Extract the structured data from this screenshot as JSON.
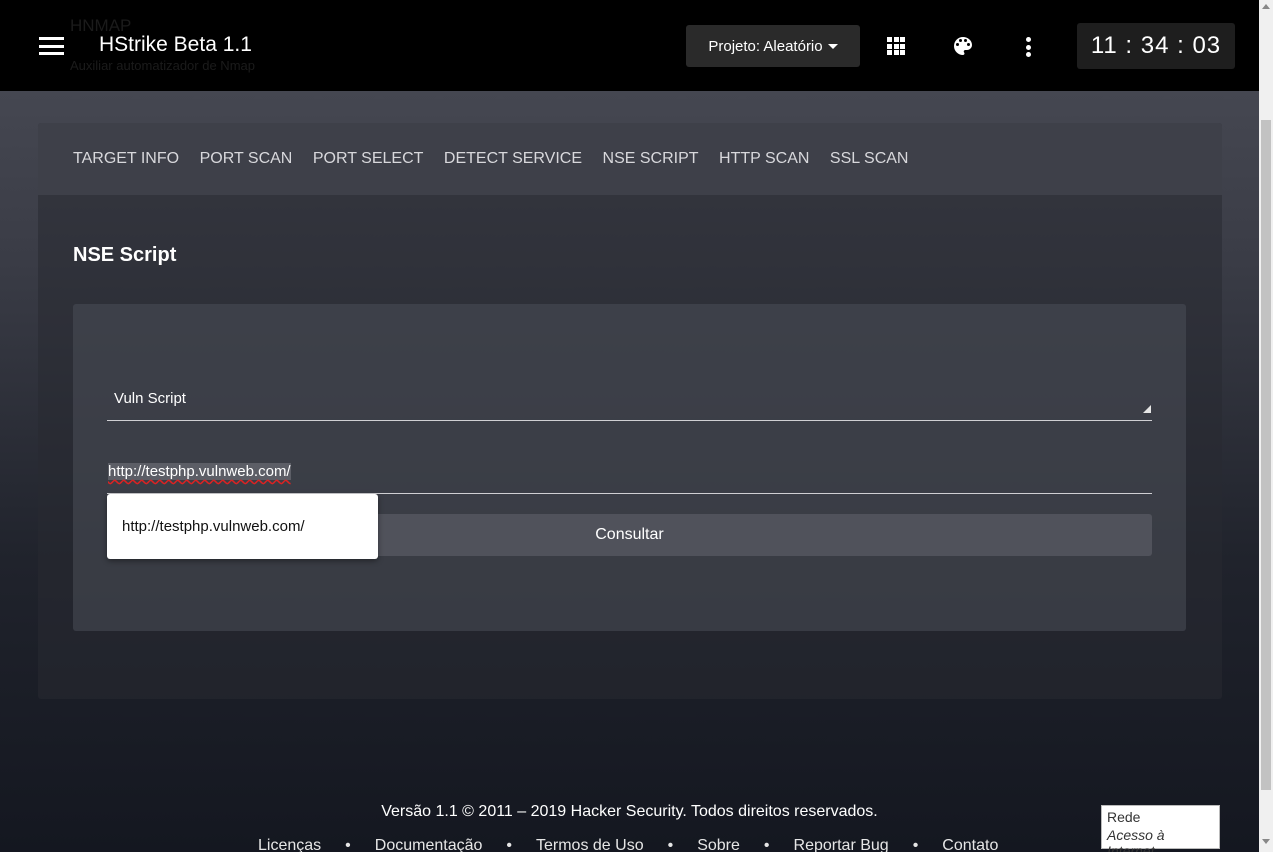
{
  "header": {
    "ghost_title": "HNMAP",
    "ghost_subtitle": "Auxiliar automatizador de Nmap",
    "app_title": "HStrike Beta 1.1",
    "project_label": "Projeto: Aleatório",
    "clock": "11 : 34 : 03"
  },
  "tabs": [
    "TARGET INFO",
    "PORT SCAN",
    "PORT SELECT",
    "DETECT SERVICE",
    "NSE SCRIPT",
    "HTTP SCAN",
    "SSL SCAN"
  ],
  "main": {
    "section_title": "NSE Script",
    "select_value": "Vuln Script",
    "url_value": "http://testphp.vulnweb.com/",
    "consult_label": "Consultar",
    "autocomplete_suggestion": "http://testphp.vulnweb.com/"
  },
  "footer": {
    "copyright": "Versão 1.1 © 2011 – 2019 Hacker Security. Todos direitos reservados.",
    "links": [
      "Licenças",
      "Documentação",
      "Termos de Uso",
      "Sobre",
      "Reportar Bug",
      "Contato"
    ],
    "separator": "•"
  },
  "tooltip": {
    "line1": "Rede",
    "line2": "Acesso à Internet"
  },
  "icons": [
    "menu-icon",
    "apps-grid-icon",
    "palette-icon",
    "more-vert-icon"
  ]
}
